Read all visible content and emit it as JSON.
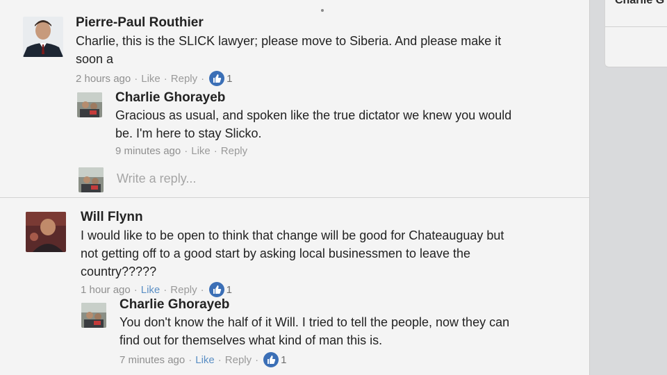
{
  "right_panel": {
    "name": "Charlie G"
  },
  "comments": [
    {
      "author": "Pierre-Paul Routhier",
      "text_line1": "Charlie, this is the SLICK lawyer; please move to Siberia. And please make it",
      "text_line2": "soon a",
      "time": "2 hours ago",
      "like": "Like",
      "reply": "Reply",
      "likes": "1",
      "avatar_icon": "man-in-suit-avatar"
    },
    {
      "author": "Charlie Ghorayeb",
      "text_line1": "Gracious as usual, and spoken like the true dictator we knew you would",
      "text_line2": "be.  I'm here to stay Slicko.",
      "time": "9 minutes ago",
      "like": "Like",
      "reply": "Reply",
      "avatar_icon": "group-photo-avatar"
    },
    {
      "author": "Will Flynn",
      "text_line1": "I would like to be open to think that change will be good for Chateauguay but",
      "text_line2": "not getting off to a good start by asking local businessmen to leave the",
      "text_line3": "country?????",
      "time": "1 hour ago",
      "like": "Like",
      "reply": "Reply",
      "likes": "1",
      "avatar_icon": "man-photo-avatar"
    },
    {
      "author": "Charlie Ghorayeb",
      "text_line1": "You don't know the half of it Will.  I tried to tell the people, now they can",
      "text_line2": "find out for themselves what kind of man this is.",
      "time": "7 minutes ago",
      "like": "Like",
      "reply": "Reply",
      "likes": "1",
      "avatar_icon": "group-photo-avatar"
    }
  ],
  "reply_box": {
    "placeholder": "Write a reply..."
  },
  "colors": {
    "link": "#5b8fc4",
    "like_badge": "#3b6fb6"
  }
}
